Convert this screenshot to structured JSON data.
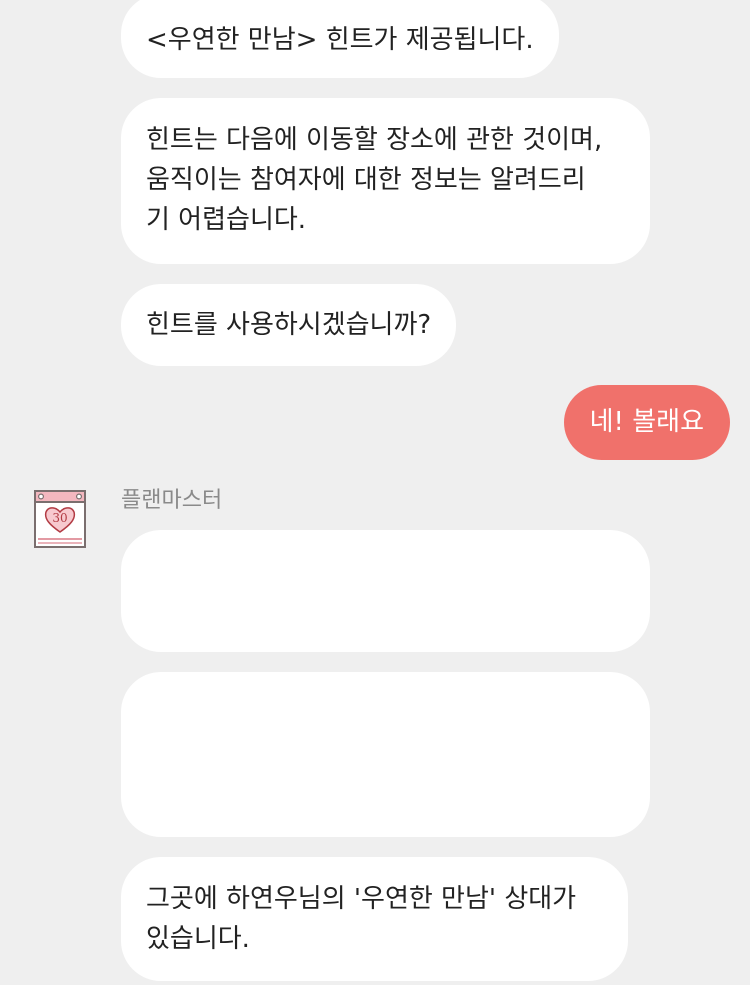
{
  "chat": {
    "messages": [
      {
        "from": "bot",
        "text": "<우연한 만남> 힌트가 제공됩니다."
      },
      {
        "from": "bot",
        "text": "힌트는 다음에 이동할 장소에 관한 것이며,\n움직이는 참여자에 대한 정보는 알려드리\n기 어렵습니다."
      },
      {
        "from": "bot",
        "text": "힌트를 사용하시겠습니까?"
      },
      {
        "from": "user",
        "text": "네! 볼래요"
      },
      {
        "from": "bot",
        "text": ""
      },
      {
        "from": "bot",
        "text": ""
      },
      {
        "from": "bot",
        "text": "그곳에 하연우님의 '우연한 만남' 상대가\n있습니다."
      }
    ],
    "sender_name": "플랜마스터",
    "avatar": {
      "icon": "calendar-heart-icon",
      "day": "30"
    }
  },
  "colors": {
    "background": "#efefef",
    "bot_bubble": "#ffffff",
    "user_bubble": "#f0716b",
    "avatar_accent": "#f3b7bf"
  }
}
